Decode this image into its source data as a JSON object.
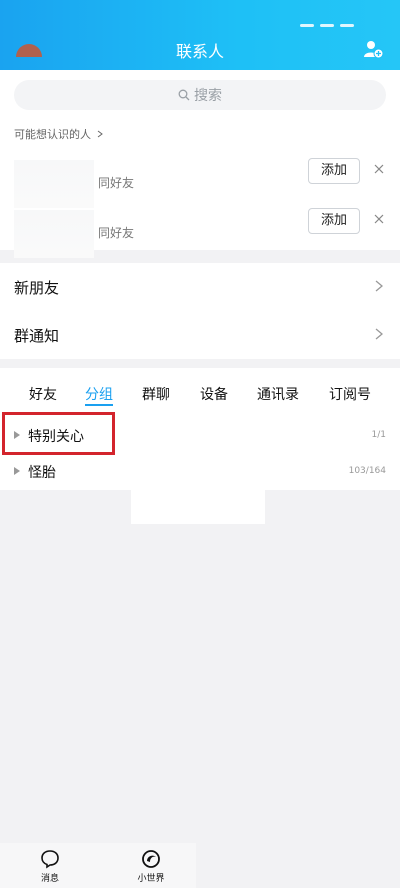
{
  "header": {
    "title": "联系人"
  },
  "search": {
    "placeholder": "搜索"
  },
  "suggestions": {
    "heading": "可能想认识的人",
    "items": [
      {
        "subtitle": "同好友",
        "add_label": "添加"
      },
      {
        "subtitle": "同好友",
        "add_label": "添加"
      }
    ]
  },
  "menu": {
    "new_friends": "新朋友",
    "group_notice": "群通知"
  },
  "tabs": [
    "好友",
    "分组",
    "群聊",
    "设备",
    "通讯录",
    "订阅号"
  ],
  "active_tab": "分组",
  "groups": [
    {
      "name": "特别关心",
      "count": "1/1"
    },
    {
      "name": "怪胎",
      "count": "103/164"
    }
  ],
  "bottom_nav": {
    "messages": "消息",
    "world": "小世界"
  },
  "colors": {
    "accent": "#1aa0f0",
    "highlight": "#d3242c"
  }
}
